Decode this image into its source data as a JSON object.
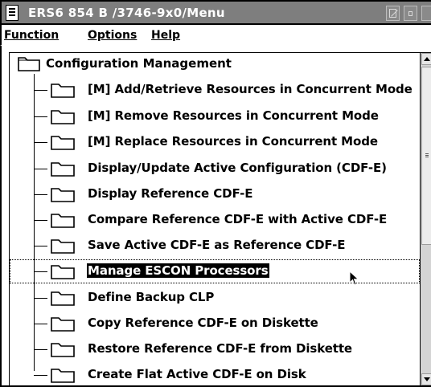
{
  "window": {
    "title": "ERS6 854 B   /3746-9x0/Menu"
  },
  "menubar": {
    "items": [
      {
        "label": "Function",
        "mnemonic": "F"
      },
      {
        "label": "Options",
        "mnemonic": "O"
      },
      {
        "label": "Help",
        "mnemonic": "H"
      }
    ]
  },
  "tree": {
    "root_label": "Configuration Management",
    "items": [
      {
        "label": "[M] Add/Retrieve Resources in Concurrent Mode"
      },
      {
        "label": "[M] Remove Resources in Concurrent Mode"
      },
      {
        "label": "[M] Replace Resources in Concurrent Mode"
      },
      {
        "label": "Display/Update Active Configuration (CDF-E)"
      },
      {
        "label": "Display Reference CDF-E"
      },
      {
        "label": "Compare Reference CDF-E with Active CDF-E"
      },
      {
        "label": "Save Active CDF-E as Reference CDF-E"
      },
      {
        "label": "Manage ESCON Processors",
        "selected": true
      },
      {
        "label": "Define Backup CLP"
      },
      {
        "label": "Copy Reference CDF-E on Diskette"
      },
      {
        "label": "Restore Reference CDF-E from Diskette"
      },
      {
        "label": "Create Flat Active CDF-E on Disk"
      }
    ]
  },
  "icons": {
    "system_menu": "system-menu-icon",
    "minimize": "minimize-icon",
    "maximize": "maximize-icon",
    "close": "close-icon",
    "folder": "folder-icon",
    "cursor": "mouse-pointer-icon"
  },
  "colors": {
    "titlebar": "#7e7e7e",
    "title_text": "#ffffff",
    "selection_bg": "#000000",
    "selection_fg": "#ffffff"
  }
}
